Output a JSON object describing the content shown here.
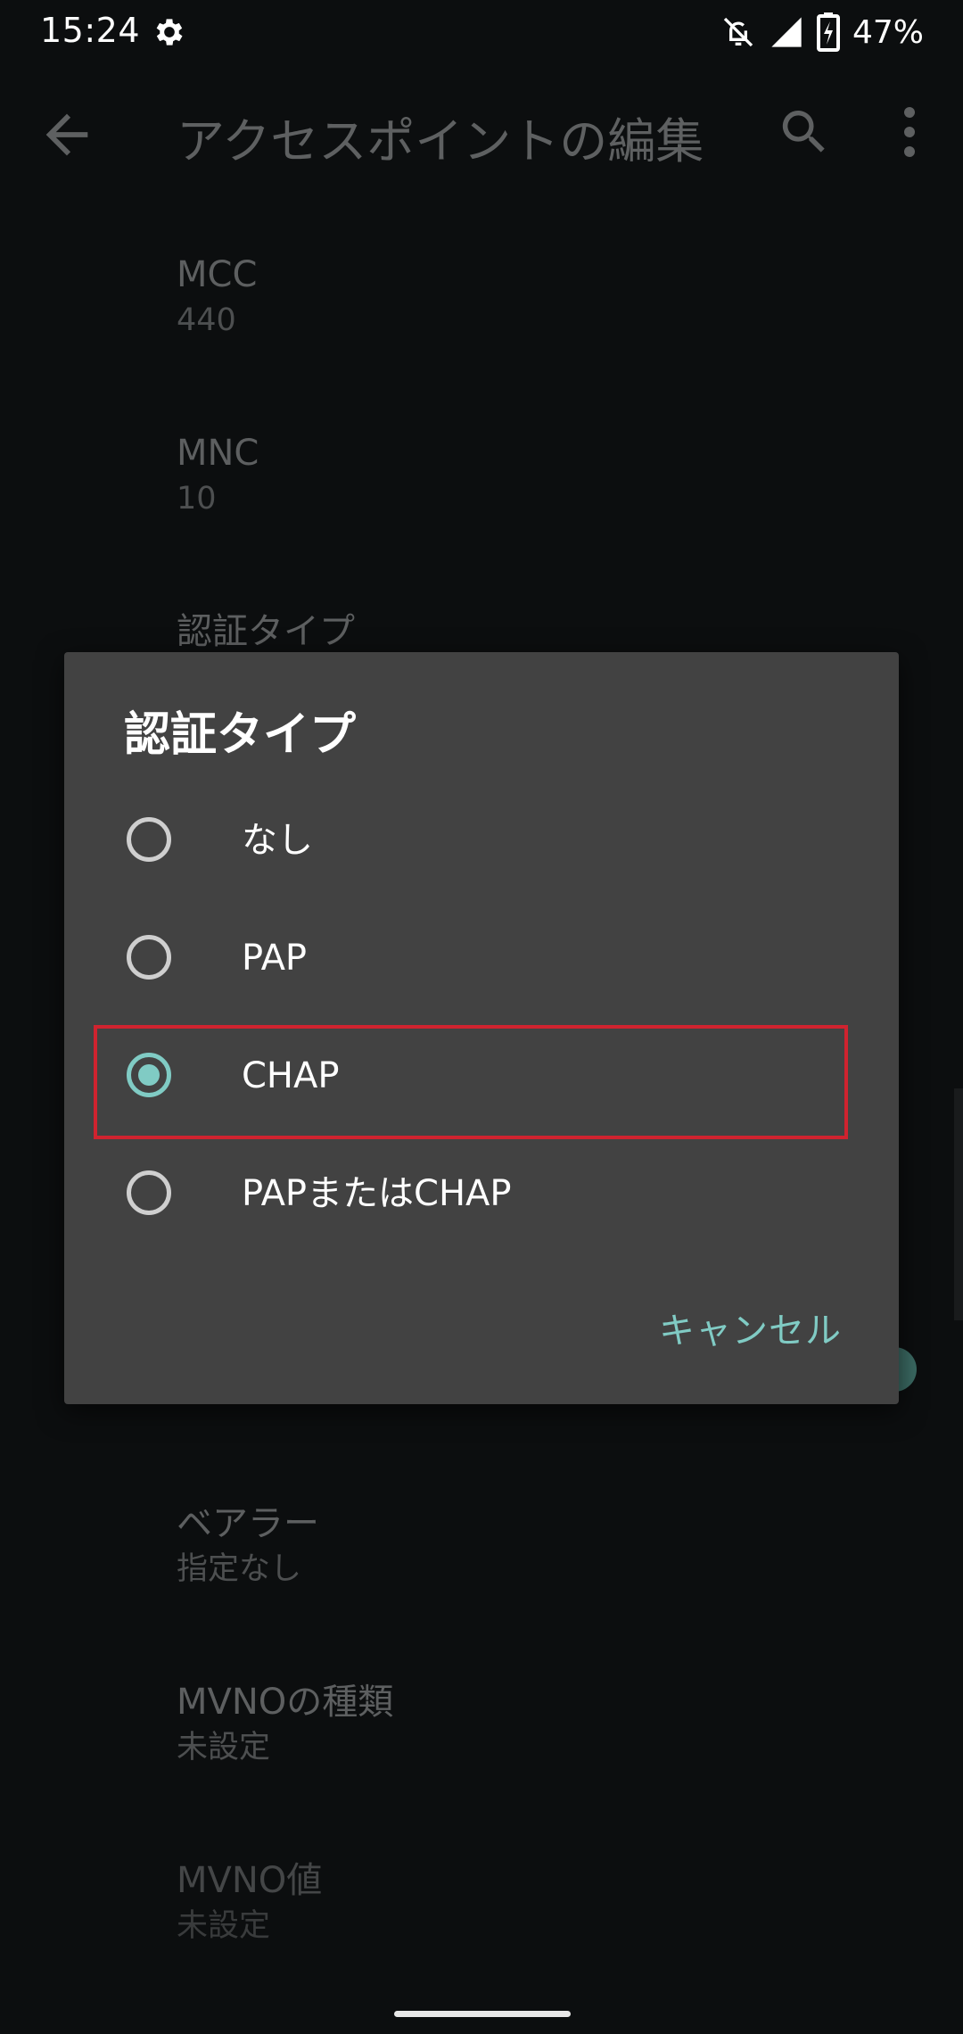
{
  "status_bar": {
    "time": "15:24",
    "battery_text": "47%",
    "icons": [
      "gear-icon",
      "notifications-off-icon",
      "signal-icon",
      "battery-charging-icon"
    ]
  },
  "app_bar": {
    "title": "アクセスポイントの編集",
    "icons": [
      "back-arrow-icon",
      "search-icon",
      "more-vert-icon"
    ]
  },
  "background_list": [
    {
      "title": "MCC",
      "summary": "440"
    },
    {
      "title": "MNC",
      "summary": "10"
    },
    {
      "title": "認証タイプ",
      "summary": ""
    },
    {
      "title": "ベアラー",
      "summary": "指定なし"
    },
    {
      "title": "MVNOの種類",
      "summary": "未設定"
    },
    {
      "title": "MVNO値",
      "summary": "未設定"
    }
  ],
  "dialog": {
    "title": "認証タイプ",
    "options": [
      {
        "label": "なし",
        "selected": false
      },
      {
        "label": "PAP",
        "selected": false
      },
      {
        "label": "CHAP",
        "selected": true
      },
      {
        "label": "PAPまたはCHAP",
        "selected": false
      }
    ],
    "cancel_label": "キャンセル"
  },
  "colors": {
    "accent": "#80cbc4",
    "highlight": "#d0232f",
    "dialog_bg": "#424242",
    "screen_bg": "#0c0e0f"
  }
}
